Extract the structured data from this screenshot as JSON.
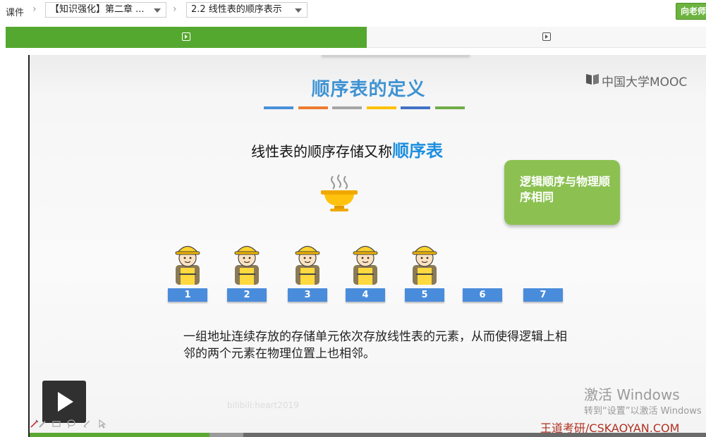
{
  "breadcrumb": {
    "root": "课件",
    "chapter_select": "【知识强化】第二章 ...",
    "lesson_select": "2.2 线性表的顺序表示",
    "ask_button": "向老师"
  },
  "tabs": [
    {
      "icon": "video-play-icon",
      "active": true
    },
    {
      "icon": "video-play-icon",
      "active": false
    }
  ],
  "slide": {
    "logo": "中国大学MOOC",
    "title": "顺序表的定义",
    "title_bar_colors": [
      "#4a90d9",
      "#ed7d31",
      "#a5a5a5",
      "#ffc000",
      "#4472c4",
      "#70ad47"
    ],
    "subtitle_prefix": "线性表的顺序存储又称",
    "subtitle_highlight": "顺序表",
    "callout": "逻辑顺序与物理顺序相同",
    "slots": [
      "1",
      "2",
      "3",
      "4",
      "5",
      "6",
      "7"
    ],
    "occupied_slots": 5,
    "description": "一组地址连续存放的存储单元依次存放线性表的元素，从而使得逻辑上相邻的两个元素在物理位置上也相邻。",
    "user_watermark": "bilibili:heart2019"
  },
  "overlay": {
    "activate_title": "激活 Windows",
    "activate_sub": "转到“设置”以激活 Windows",
    "brand": "王道考研/CSKAOYAN.COM"
  },
  "player": {
    "progress": 0.265
  },
  "colors": {
    "accent_green": "#55a82f",
    "title_blue": "#3f93d3",
    "slot_blue": "#4a8cdc",
    "callout_green": "#8cc152"
  }
}
